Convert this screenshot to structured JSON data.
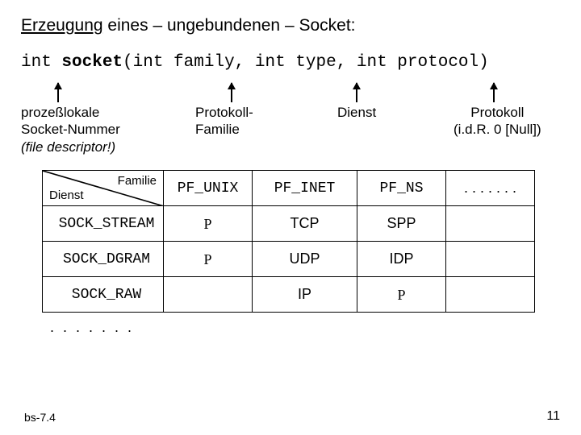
{
  "title": {
    "underlined": "Erzeugung",
    "rest": " eines – ungebundenen – Socket:"
  },
  "sig": {
    "p1": "int ",
    "fn": "socket",
    "p2": "(int family, int type, int protocol)"
  },
  "labels": {
    "l1a": "prozeßlokale",
    "l1b": "Socket-Nummer",
    "l1c": "(file descriptor!)",
    "l2a": "Protokoll-",
    "l2b": "Familie",
    "l3": "Dienst",
    "l4a": "Protokoll",
    "l4b": "(i.d.R.  0 [Null])"
  },
  "table": {
    "corner_tr": "Familie",
    "corner_bl": "Dienst",
    "cols": [
      "PF_UNIX",
      "PF_INET",
      "PF_NS",
      ". . . . . . ."
    ],
    "rows": [
      {
        "h": "SOCK_STREAM",
        "cells": [
          "hand",
          "TCP",
          "SPP",
          ""
        ]
      },
      {
        "h": "SOCK_DGRAM",
        "cells": [
          "hand",
          "UDP",
          "IDP",
          ""
        ]
      },
      {
        "h": "SOCK_RAW",
        "cells": [
          "",
          "IP",
          "hand",
          ""
        ]
      }
    ],
    "handglyph": "P"
  },
  "dots": ". . . . . . .",
  "footer": {
    "left": "bs-7.4",
    "right": "11"
  }
}
